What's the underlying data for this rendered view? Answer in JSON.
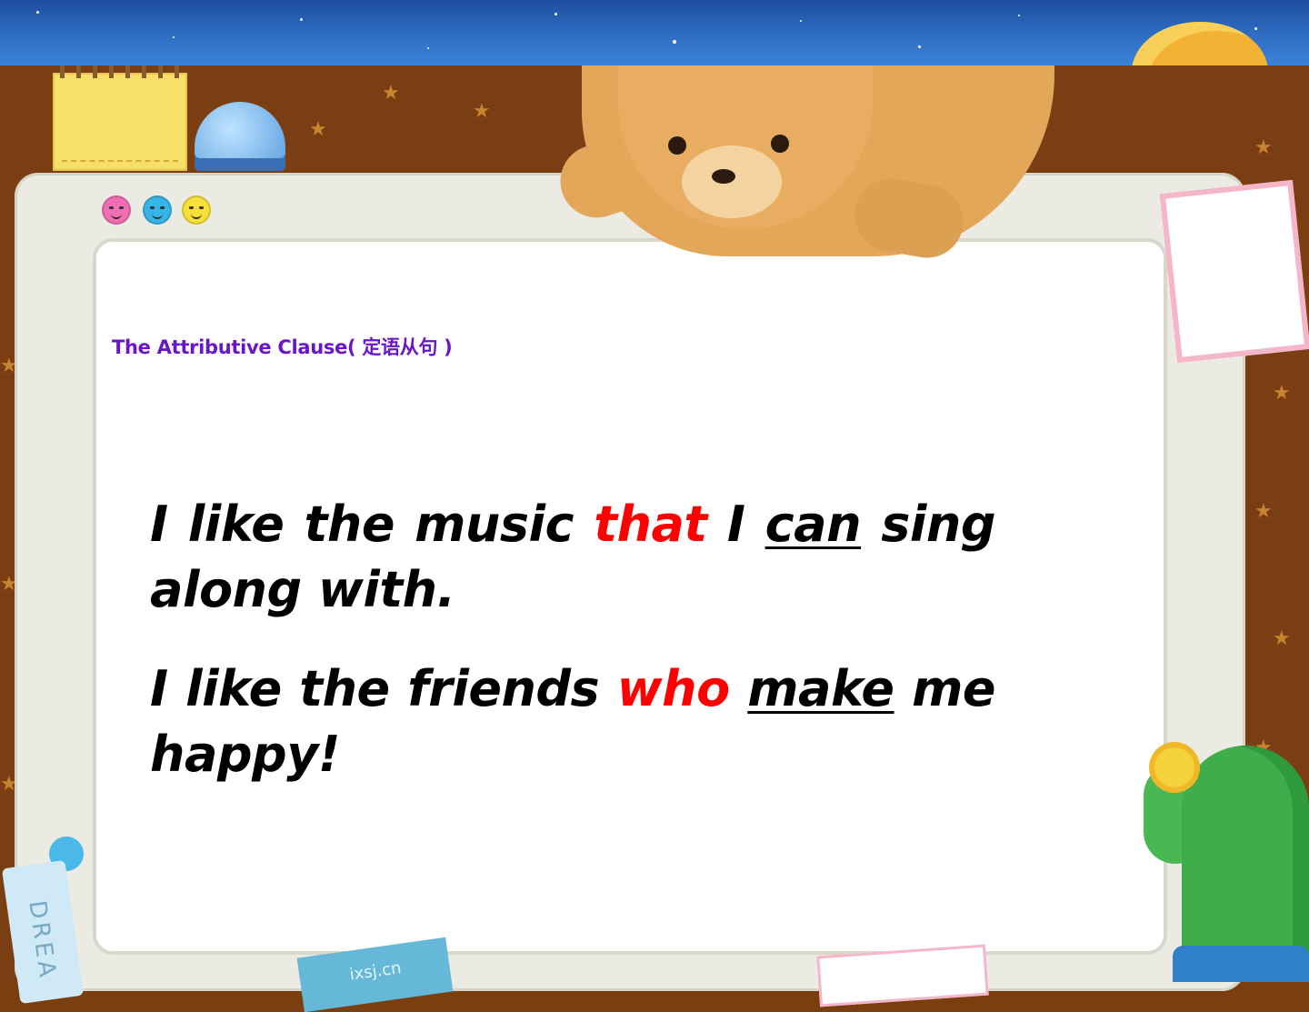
{
  "slide": {
    "title": "The Attributive Clause( 定语从句 )",
    "sentences": [
      {
        "before": "I like the music ",
        "relative": "that",
        "middle": " I ",
        "verb": "can",
        "after": " sing along with."
      },
      {
        "before": "I like the friends ",
        "relative": "who",
        "middle": " ",
        "verb": "make",
        "after": " me happy!"
      }
    ]
  },
  "decor": {
    "tag_text": "DREA",
    "bottom_tag_text": "ixsj.cn",
    "relative_color": "#ff0000",
    "title_color": "#6a16c8",
    "face_colors": [
      "#f06fb2",
      "#38b5e6",
      "#f7e03a"
    ]
  }
}
